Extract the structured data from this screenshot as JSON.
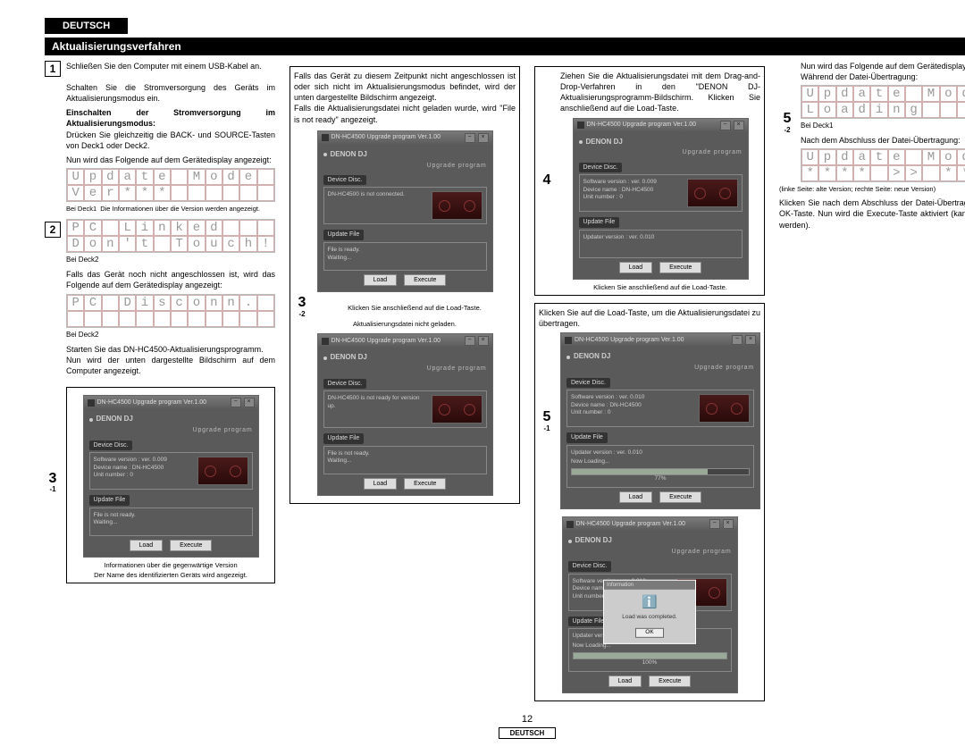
{
  "lang": "DEUTSCH",
  "sectionTitle": "Aktualisierungsverfahren",
  "pageNum": "12",
  "winTitle": "DN-HC4500 Upgrade program Ver.1.00",
  "logoText": "DENON DJ",
  "upgLabel": "Upgrade program",
  "tagDevice": "Device Disc.",
  "tagUpdate": "Update File",
  "devInfo1": "Software version : ver. 0.009",
  "devInfo2": "Device name : DN-HC4500",
  "devInfo3": "Unit number : 0",
  "devInfo1b": "Software version : ver. 0.010",
  "devNotConn": "DN-HC4500 is not connected.",
  "devNotReady": "DN-HC4500 is not ready for version up.",
  "upReady": "File is ready.\nWaiting...",
  "upNotReady": "File is not ready.\nWaiting...",
  "upUpdater": "Updater version : ver. 0.010",
  "upNowLoading": "Now Loading...",
  "upPct": "77%",
  "upDone": "100%",
  "btnLoad": "Load",
  "btnExecute": "Execute",
  "popTitle": "Information",
  "popMsg": "Load was completed.",
  "popOK": "OK",
  "c1": {
    "s1": "Schließen Sie den Computer mit einem USB-Kabel an.",
    "s2a": "Schalten Sie die Stromversorgung des Geräts im Aktualisierungsmodus ein.",
    "s2bold": "Einschalten der Stromversorgung im Aktualisierungsmodus:",
    "s2b": "Drücken Sie gleichzeitig die BACK- und SOURCE-Tasten von Deck1 oder Deck2.",
    "s2c": "Nun wird das Folgende auf dem Gerätedisplay angezeigt:",
    "lcd1a": "Update Mode",
    "lcd1b": "Ver***      ",
    "lcdInfoL": "Bei Deck1",
    "lcdInfoR": "Die Informationen über die Version werden angezeigt.",
    "lcd2a": "PC Linked   ",
    "lcd2b": "Don't Touch!",
    "deck2": "Bei Deck2",
    "s2d": "Falls das Gerät noch nicht angeschlossen ist, wird das Folgende auf dem Gerätedisplay angezeigt:",
    "lcd3a": "PC Disconn. ",
    "lcd3b": "            ",
    "s2e": "Starten Sie das DN-HC4500-Aktualisierungsprogramm.",
    "s2f": "Nun wird der unten dargestellte Bildschirm auf dem Computer angezeigt.",
    "cap3_1a": "Informationen über die gegenwärtige Version",
    "cap3_1b": "Der Name des identifizierten Geräts wird angezeigt."
  },
  "c2": {
    "s3_2": "Falls das Gerät zu diesem Zeitpunkt nicht angeschlossen ist oder sich nicht im Aktualisierungsmodus befindet, wird der unten dargestellte Bildschirm angezeigt.\nFalls die Aktualisierungsdatei nicht geladen wurde, wird \"File is not ready\" angezeigt.",
    "cap3_2a": "Klicken Sie anschließend auf die Load-Taste.",
    "cap3_2b": "Aktualisierungsdatei nicht geladen."
  },
  "c3": {
    "s4a": "Ziehen Sie die Aktualisierungsdatei mit dem Drag-and-Drop-Verfahren in den \"DENON DJ-Aktualisierungsprogramm-Bildschirm. Klicken Sie anschließend auf die Load-Taste.",
    "s5": "Klicken Sie auf die Load-Taste, um die Aktualisierungsdatei zu übertragen."
  },
  "c4": {
    "s5_2a": "Nun wird das Folgende auf dem Gerätedisplay angezeigt:",
    "s5_2b": "Während der Datei-Übertragung:",
    "lcd4a": "Update Mode ",
    "lcd4b": "Loading     ",
    "deck1": "Bei Deck1",
    "s5_2c": "Nach dem Abschluss der Datei-Übertragung:",
    "lcd5a": "Update Mode ",
    "lcd5b": "**** >> ****",
    "lcdLegend": "(linke Seite: alte Version; rechte Seite: neue Version)",
    "s5_2d": "Klicken Sie nach dem Abschluss der Datei-Übertragung auf die OK-Taste. Nun wird die Execute-Taste aktiviert (kann angeklickt werden)."
  }
}
